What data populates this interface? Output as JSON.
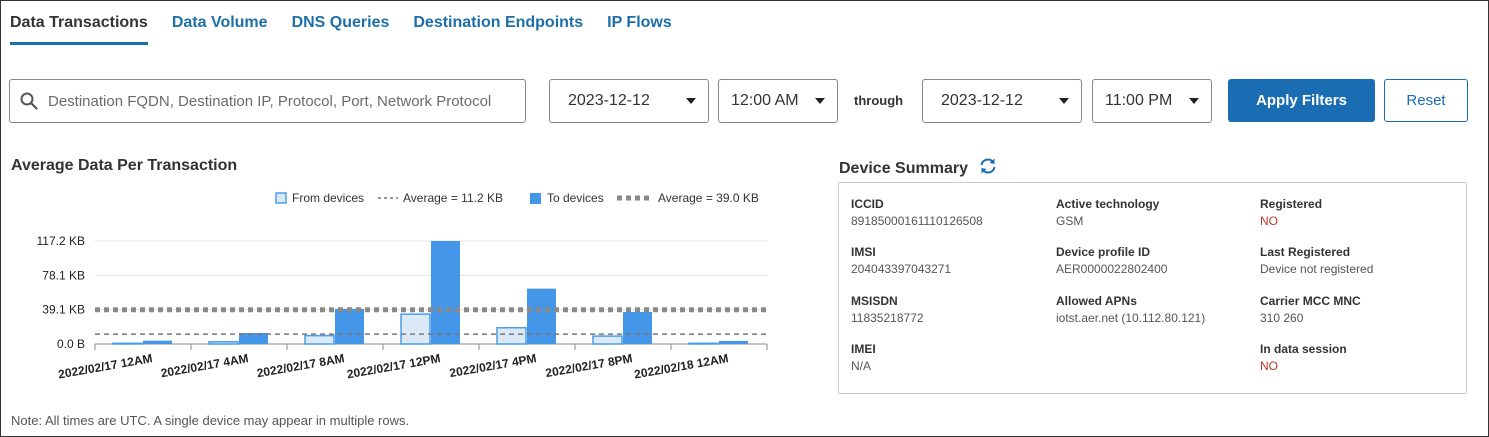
{
  "tabs": [
    {
      "label": "Data Transactions",
      "active": true
    },
    {
      "label": "Data Volume"
    },
    {
      "label": "DNS Queries"
    },
    {
      "label": "Destination Endpoints"
    },
    {
      "label": "IP Flows"
    }
  ],
  "filters": {
    "search_placeholder": "Destination FQDN, Destination IP, Protocol, Port, Network Protocol",
    "start_date": "2023-12-12",
    "start_time": "12:00 AM",
    "through_label": "through",
    "end_date": "2023-12-12",
    "end_time": "11:00 PM",
    "apply_label": "Apply Filters",
    "reset_label": "Reset"
  },
  "chart": {
    "title": "Average Data Per Transaction",
    "note": "Note: All times are UTC. A single device may appear in multiple rows."
  },
  "chart_data": {
    "type": "bar",
    "categories": [
      "2022/02/17 12AM",
      "2022/02/17 4AM",
      "2022/02/17 8AM",
      "2022/02/17 12PM",
      "2022/02/17 4PM",
      "2022/02/17 8PM",
      "2022/02/18 12AM"
    ],
    "series": [
      {
        "name": "From devices",
        "values": [
          0.8,
          2.5,
          9.5,
          34.0,
          18.5,
          9.0,
          0.8
        ],
        "color": "#dbe9f7",
        "stroke": "#4a9ee8"
      },
      {
        "name": "To devices",
        "values": [
          3.8,
          12.5,
          40.0,
          117.2,
          63.0,
          36.5,
          3.5
        ],
        "color": "#4497e8"
      }
    ],
    "reference_lines": [
      {
        "name": "Average = 11.2 KB",
        "value": 11.2,
        "style": "thin-dashed"
      },
      {
        "name": "Average = 39.0 KB",
        "value": 39.0,
        "style": "thick-dotted"
      }
    ],
    "yticks": [
      "0.0 B",
      "39.1 KB",
      "78.1 KB",
      "117.2 KB"
    ],
    "ytick_values": [
      0,
      39.1,
      78.1,
      117.2
    ],
    "ylim": [
      0,
      117.2
    ],
    "legend": "top-right",
    "grid": true
  },
  "device_summary": {
    "title": "Device Summary",
    "refresh_icon": "refresh-icon",
    "fields": [
      {
        "label": "ICCID",
        "value": "89185000161110126508"
      },
      {
        "label": "Active technology",
        "value": "GSM"
      },
      {
        "label": "Registered",
        "value": "NO",
        "status": "red"
      },
      {
        "label": "IMSI",
        "value": "204043397043271"
      },
      {
        "label": "Device profile ID",
        "value": "AER0000022802400"
      },
      {
        "label": "Last Registered",
        "value": "Device not registered"
      },
      {
        "label": "MSISDN",
        "value": "11835218772"
      },
      {
        "label": "Allowed APNs",
        "value": "iotst.aer.net (10.112.80.121)"
      },
      {
        "label": "Carrier MCC MNC",
        "value": "310 260"
      },
      {
        "label": "IMEI",
        "value": "N/A"
      },
      {
        "label": "In data session",
        "value": "NO",
        "status": "red"
      }
    ]
  }
}
